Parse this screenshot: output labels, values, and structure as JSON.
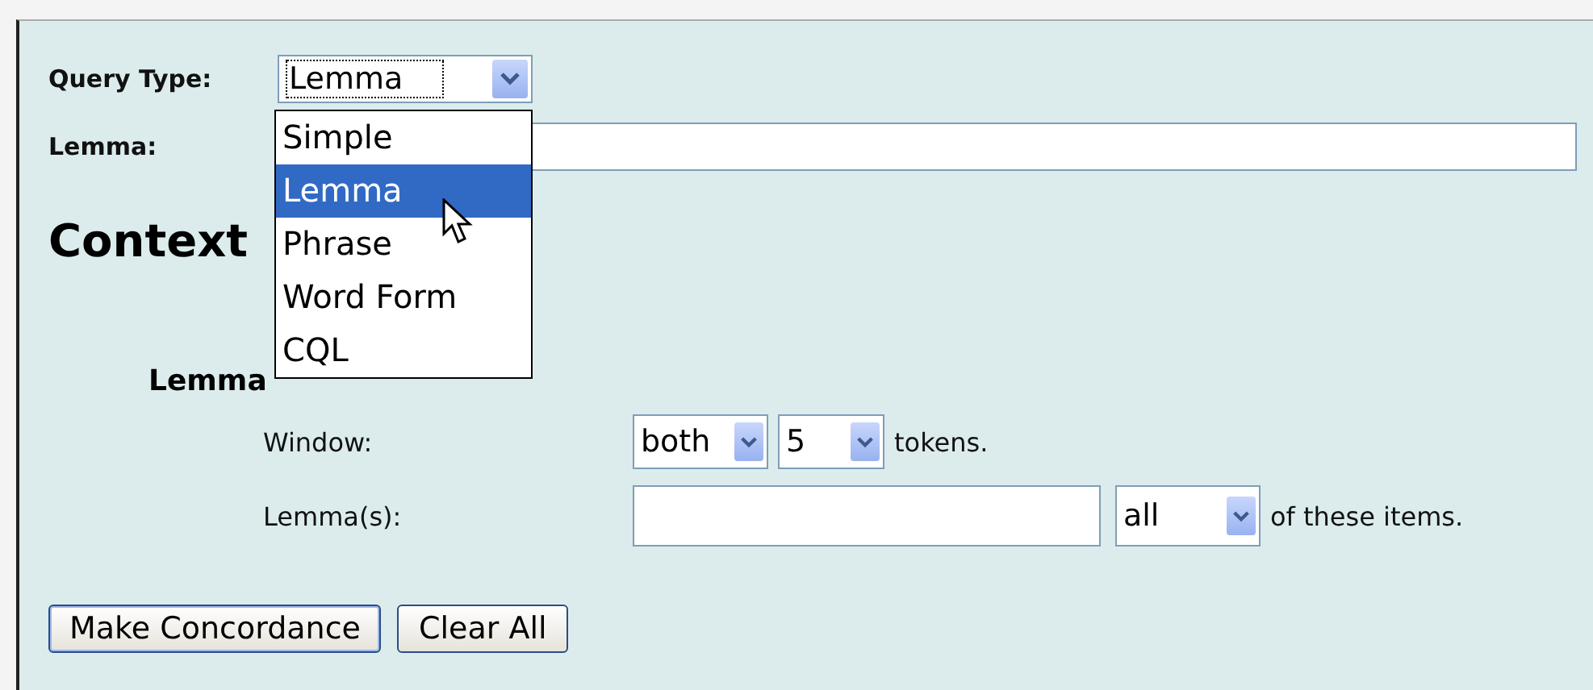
{
  "query_type": {
    "label": "Query Type:",
    "value": "Lemma",
    "options": [
      {
        "label": "Simple",
        "selected": false
      },
      {
        "label": "Lemma",
        "selected": true
      },
      {
        "label": "Phrase",
        "selected": false
      },
      {
        "label": "Word Form",
        "selected": false
      },
      {
        "label": "CQL",
        "selected": false
      }
    ]
  },
  "lemma": {
    "label": "Lemma:"
  },
  "context": {
    "heading": "Context",
    "filter": {
      "heading": "Lemma",
      "window": {
        "label": "Window:",
        "direction": "both",
        "size": "5",
        "suffix": "tokens."
      },
      "lemmas": {
        "label": "Lemma(s):",
        "mode": "all",
        "suffix": "of these items."
      }
    }
  },
  "buttons": [
    "Make Concordance",
    "Clear All"
  ]
}
